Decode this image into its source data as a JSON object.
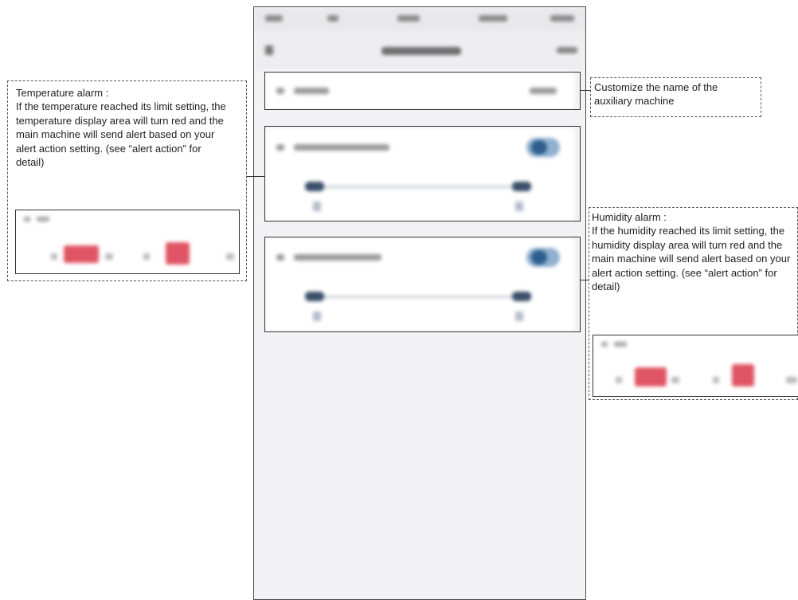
{
  "callouts": {
    "temperature": {
      "title": "Temperature alarm :",
      "body": "If the temperature reached its limit setting, the temperature display area will turn red and the main machine will send alert based on your alert action setting. (see “alert action” for detail)"
    },
    "name": {
      "body": "Customize the name of the auxiliary machine"
    },
    "humidity": {
      "title": "Humidity alarm :",
      "body": "If the humidity reached its limit setting, the humidity display area will turn red and the main machine will send alert based on your alert action setting. (see “alert action” for detail)"
    }
  },
  "phone": {
    "temperature_alarm_toggle": true,
    "humidity_alarm_toggle": true
  },
  "colors": {
    "alarm_red": "#e05565",
    "toggle_on": "#2f5d8d"
  }
}
